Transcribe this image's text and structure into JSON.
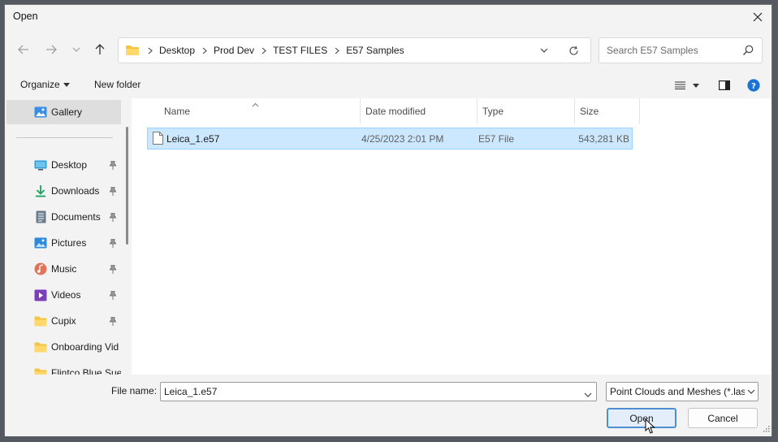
{
  "window": {
    "title": "Open"
  },
  "address": {
    "crumbs": [
      "Desktop",
      "Prod Dev",
      "TEST FILES",
      "E57 Samples"
    ]
  },
  "search": {
    "placeholder": "Search E57 Samples"
  },
  "toolbar": {
    "organize_label": "Organize",
    "new_folder_label": "New folder"
  },
  "sidebar": {
    "items": [
      {
        "label": "Gallery",
        "icon": "gallery-icon",
        "pinned": false
      },
      {
        "label": "Desktop",
        "icon": "desktop-icon",
        "pinned": true
      },
      {
        "label": "Downloads",
        "icon": "downloads-icon",
        "pinned": true
      },
      {
        "label": "Documents",
        "icon": "documents-icon",
        "pinned": true
      },
      {
        "label": "Pictures",
        "icon": "pictures-icon",
        "pinned": true
      },
      {
        "label": "Music",
        "icon": "music-icon",
        "pinned": true
      },
      {
        "label": "Videos",
        "icon": "videos-icon",
        "pinned": true
      },
      {
        "label": "Cupix",
        "icon": "folder-icon",
        "pinned": true
      },
      {
        "label": "Onboarding Vid",
        "icon": "folder-icon",
        "pinned": false
      },
      {
        "label": "Flintco Blue Sue",
        "icon": "folder-icon",
        "pinned": false
      }
    ]
  },
  "file_list": {
    "columns": [
      "Name",
      "Date modified",
      "Type",
      "Size"
    ],
    "rows": [
      {
        "name": "Leica_1.e57",
        "date": "4/25/2023 2:01 PM",
        "type": "E57 File",
        "size": "543,281 KB",
        "selected": true
      }
    ]
  },
  "footer": {
    "file_name_label": "File name:",
    "file_name_value": "Leica_1.e57",
    "file_type_value": "Point Clouds and Meshes (*.las,",
    "open_label": "Open",
    "cancel_label": "Cancel"
  },
  "colors": {
    "selection_bg": "#cce8ff",
    "selection_border": "#99d1ff",
    "accent": "#0067c0"
  }
}
